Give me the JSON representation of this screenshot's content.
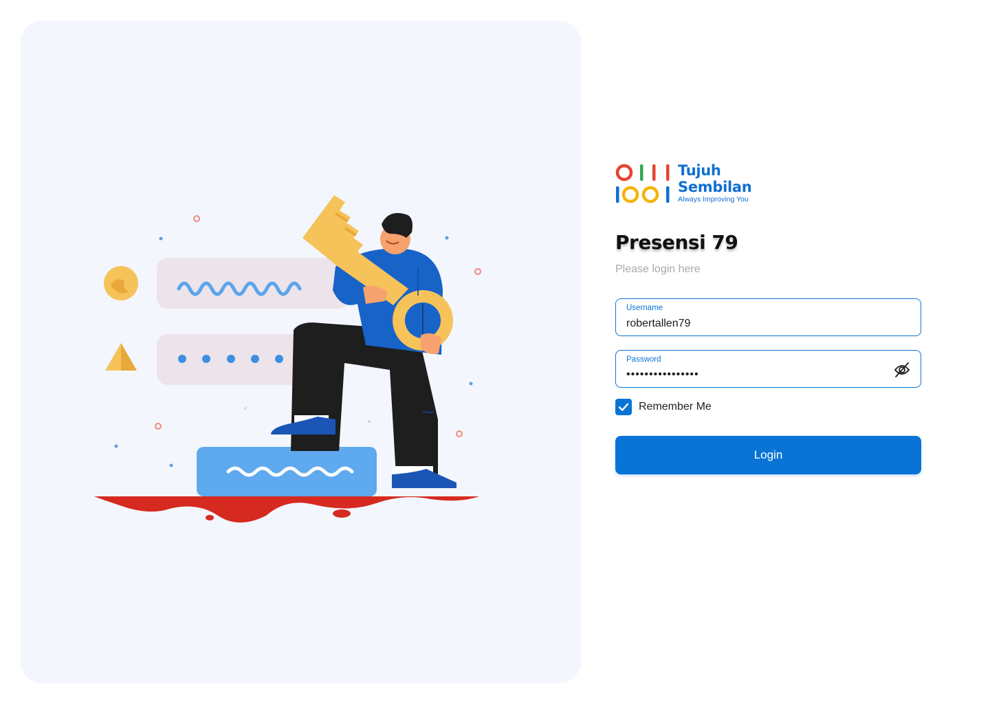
{
  "brand": {
    "name_line1": "Tujuh",
    "name_line2": "Sembilan",
    "tagline": "Always Improving You",
    "primary_color": "#0a74d6"
  },
  "login": {
    "title": "Presensi 79",
    "subtitle": "Please login here",
    "username": {
      "label": "Username",
      "value": "robertallen79"
    },
    "password": {
      "label": "Password",
      "value": "••••••••••••••••",
      "toggle_icon": "eye-off-icon"
    },
    "remember_me": {
      "label": "Remember Me",
      "checked": true
    },
    "submit_label": "Login"
  },
  "illustration": {
    "subject": "man-holding-key-illustration"
  }
}
